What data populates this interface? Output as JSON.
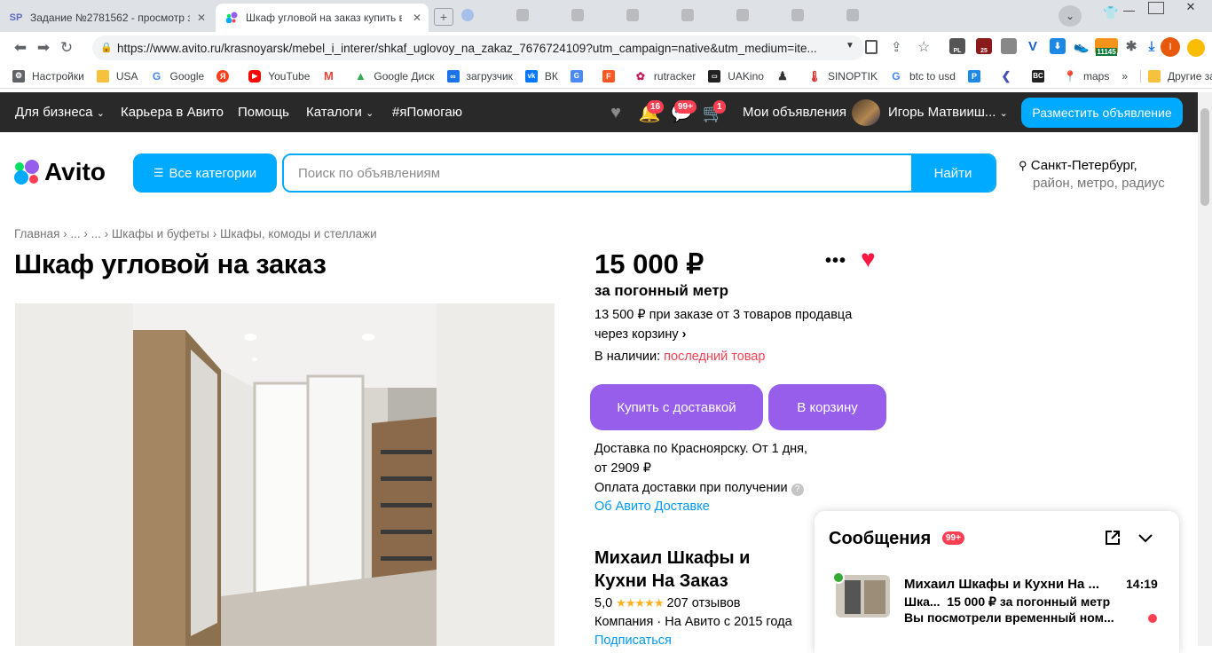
{
  "browser": {
    "tabs": [
      {
        "favicon": "SP",
        "title": "Задание №2781562 - просмотр з"
      },
      {
        "favicon": "avito-icon",
        "title": "Шкаф угловой на заказ купить в"
      }
    ],
    "new_tab_icon": "new-tab-icon",
    "url": "https://www.avito.ru/krasnoyarsk/mebel_i_interer/shkaf_uglovoy_na_zakaz_7676724109?utm_campaign=native&utm_medium=ite...",
    "ext_counter": "11145",
    "ext_badge_pl": "PL",
    "ext_badge_25": "25",
    "profile_letter": "I"
  },
  "bookmarks": [
    {
      "label": "Настройки",
      "color": "#5f6368"
    },
    {
      "label": "USA",
      "color": "#f6c23e"
    },
    {
      "label": "Google",
      "color": "#4285f4"
    },
    {
      "label": "",
      "color": "#fc3f1d",
      "glyph": "Я"
    },
    {
      "label": "YouTube",
      "color": "#ff0000"
    },
    {
      "label": "",
      "color": "#ea4335",
      "glyph": "M"
    },
    {
      "label": "Google Диск",
      "color": "#34a853"
    },
    {
      "label": "загрузчик",
      "color": "#1a73e8"
    },
    {
      "label": "ВК",
      "color": "#0077ff"
    },
    {
      "label": "",
      "color": "#4b8bf5"
    },
    {
      "label": "",
      "color": "#ff5722"
    },
    {
      "label": "rutracker",
      "color": "#c2185b"
    },
    {
      "label": "UAKino",
      "color": "#222222"
    },
    {
      "label": "",
      "color": "#333333"
    },
    {
      "label": "SINOPTIK",
      "color": "#d32f2f"
    },
    {
      "label": "btc to usd",
      "color": "#4285f4"
    },
    {
      "label": "",
      "color": "#1e88e5",
      "glyph": "P"
    },
    {
      "label": "",
      "color": "#3f51b5"
    },
    {
      "label": "",
      "color": "#222222",
      "glyph": "BC"
    },
    {
      "label": "maps",
      "color": "#34a853"
    },
    {
      "label": "Другие закладки",
      "color": "#f6c23e"
    }
  ],
  "avito_header": {
    "nav": [
      "Для бизнеса",
      "Карьера в Авито",
      "Помощь",
      "Каталоги",
      "#яПомогаю"
    ],
    "badge_notifications": "16",
    "badge_messages": "99+",
    "badge_cart": "1",
    "my_ads": "Мои объявления",
    "user_name": "Игорь Матвииш...",
    "place_ad": "Разместить объявление"
  },
  "search": {
    "logo": "Avito",
    "categories_btn": "Все категории",
    "placeholder": "Поиск по объявлениям",
    "find_btn": "Найти",
    "location": "Санкт-Петербург,",
    "location_sub": "район, метро, радиус"
  },
  "breadcrumbs": [
    "Главная",
    "...",
    "...",
    "Шкафы и буфеты",
    "Шкафы, комоды и стеллажи"
  ],
  "listing": {
    "title": "Шкаф угловой на заказ",
    "price": "15 000 ₽",
    "price_unit": "за погонный метр",
    "bulk_price_1": "13 500 ₽ при заказе от 3 товаров продавца",
    "bulk_price_2": "через корзину",
    "availability_label": "В наличии:",
    "availability_value": "последний товар",
    "buy_btn": "Купить с доставкой",
    "cart_btn": "В корзину",
    "delivery_1": "Доставка по Красноярску. От 1 дня,",
    "delivery_2": "от 2909 ₽",
    "payment": "Оплата доставки при получении",
    "about_delivery": "Об Авито Доставке"
  },
  "seller": {
    "name_line1": "Михаил Шкафы и",
    "name_line2": "Кухни На Заказ",
    "rating": "5,0",
    "stars": 5,
    "reviews": "207 отзывов",
    "info": "Компания · На Авито с 2015 года",
    "subscribe": "Подписаться"
  },
  "messages": {
    "title": "Сообщения",
    "badge": "99+",
    "item": {
      "name": "Михаил Шкафы и Кухни На ...",
      "time": "14:19",
      "line2_prefix": "Шка...",
      "line2_price": "15 000 ₽ за погонный метр",
      "line3": "Вы посмотрели временный ном..."
    }
  },
  "colors": {
    "avito_blue": "#00aaff",
    "purple": "#965eeb",
    "header_dark": "#292929",
    "favorite_red": "#ff1744"
  }
}
